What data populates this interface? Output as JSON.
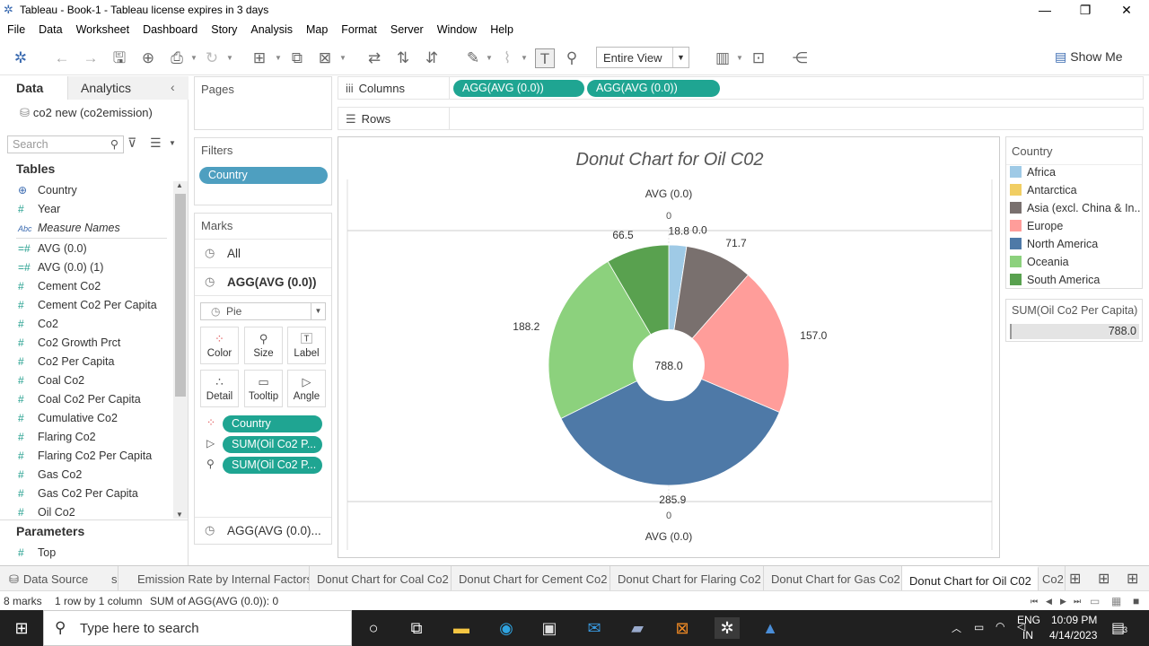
{
  "window": {
    "title": "Tableau - Book-1 - Tableau license expires in 3 days"
  },
  "menu": [
    "File",
    "Data",
    "Worksheet",
    "Dashboard",
    "Story",
    "Analysis",
    "Map",
    "Format",
    "Server",
    "Window",
    "Help"
  ],
  "toolbar": {
    "fit_value": "Entire View",
    "show_me_label": "Show Me"
  },
  "data_pane": {
    "tab_data": "Data",
    "tab_analytics": "Analytics",
    "datasource": "co2 new (co2emission)",
    "search_placeholder": "Search",
    "tables_heading": "Tables",
    "fields": [
      {
        "name": "Country",
        "type": "geo"
      },
      {
        "name": "Year",
        "type": "measure"
      },
      {
        "name": "Measure Names",
        "type": "abc"
      },
      {
        "name": "AVG (0.0)",
        "type": "calc"
      },
      {
        "name": "AVG (0.0) (1)",
        "type": "calc"
      },
      {
        "name": "Cement Co2",
        "type": "measure"
      },
      {
        "name": "Cement Co2 Per Capita",
        "type": "measure"
      },
      {
        "name": "Co2",
        "type": "measure"
      },
      {
        "name": "Co2 Growth Prct",
        "type": "measure"
      },
      {
        "name": "Co2 Per Capita",
        "type": "measure"
      },
      {
        "name": "Coal Co2",
        "type": "measure"
      },
      {
        "name": "Coal Co2 Per Capita",
        "type": "measure"
      },
      {
        "name": "Cumulative Co2",
        "type": "measure"
      },
      {
        "name": "Flaring Co2",
        "type": "measure"
      },
      {
        "name": "Flaring Co2 Per Capita",
        "type": "measure"
      },
      {
        "name": "Gas Co2",
        "type": "measure"
      },
      {
        "name": "Gas Co2 Per Capita",
        "type": "measure"
      },
      {
        "name": "Oil Co2",
        "type": "measure"
      }
    ],
    "parameters_heading": "Parameters",
    "parameters": [
      "Top"
    ]
  },
  "cards": {
    "pages_title": "Pages",
    "filters_title": "Filters",
    "filter_pill": "Country",
    "marks_title": "Marks",
    "marks_all": "All",
    "marks_agg": "AGG(AVG (0.0))",
    "mark_type": "Pie",
    "mark_buttons": [
      "Color",
      "Size",
      "Label",
      "Detail",
      "Tooltip",
      "Angle"
    ],
    "mark_pills": [
      "Country",
      "SUM(Oil Co2 P...",
      "SUM(Oil Co2 P..."
    ],
    "marks_bottom": "AGG(AVG (0.0)..."
  },
  "shelves": {
    "columns_label": "Columns",
    "rows_label": "Rows",
    "column_pills": [
      "AGG(AVG (0.0))",
      "AGG(AVG (0.0))"
    ]
  },
  "view": {
    "title": "Donut Chart for Oil C02",
    "top_axis_title": "AVG (0.0)",
    "top_axis_tick": "0",
    "bottom_axis_tick": "0",
    "bottom_axis_title": "AVG (0.0)",
    "center_label": "788.0"
  },
  "chart_data": {
    "type": "pie",
    "title": "Donut Chart for Oil C02",
    "categories": [
      "Africa",
      "Antarctica",
      "Asia (excl. China & In..",
      "Europe",
      "North America",
      "Oceania",
      "South America"
    ],
    "values": [
      18.8,
      0.0,
      71.7,
      157.0,
      285.9,
      188.2,
      66.5
    ],
    "colors": [
      "#9fcae6",
      "#f1ce63",
      "#79706e",
      "#ff9d9a",
      "#4e79a7",
      "#8cd17d",
      "#59a14f"
    ],
    "total": 788.0,
    "legend_placement": "right"
  },
  "legend": {
    "title": "Country",
    "size_title": "SUM(Oil Co2 Per Capita)",
    "size_value": "788.0"
  },
  "sheet_tabs": [
    "Data Source",
    "s",
    "Emission Rate by Internal Factors",
    "Donut Chart for Coal Co2",
    "Donut Chart for Cement Co2",
    "Donut Chart for Flaring Co2",
    "Donut Chart for Gas Co2",
    "Donut Chart for Oil C02",
    "Co2"
  ],
  "status": {
    "marks": "8 marks",
    "rows_cols": "1 row by 1 column",
    "sum": "SUM of AGG(AVG (0.0)): 0"
  },
  "taskbar": {
    "search_placeholder": "Type here to search",
    "lang_top": "ENG",
    "lang_bottom": "IN",
    "time": "10:09 PM",
    "date": "4/14/2023",
    "notif_count": "3"
  }
}
